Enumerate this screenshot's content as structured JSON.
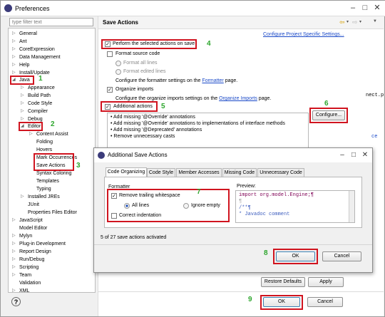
{
  "window": {
    "title": "Preferences"
  },
  "filter": {
    "placeholder": "type filter text"
  },
  "tree": {
    "general": "General",
    "ant": "Ant",
    "coreexpression": "CoreExpression",
    "data_management": "Data Management",
    "help": "Help",
    "install_update": "Install/Update",
    "java": "Java",
    "appearance": "Appearance",
    "build_path": "Build Path",
    "code_style": "Code Style",
    "compiler": "Compiler",
    "debug": "Debug",
    "editor": "Editor",
    "content_assist": "Content Assist",
    "folding": "Folding",
    "hovers": "Hovers",
    "mark_occurrences": "Mark Occurrences",
    "save_actions": "Save Actions",
    "syntax_coloring": "Syntax Coloring",
    "templates": "Templates",
    "typing": "Typing",
    "installed_jres": "Installed JREs",
    "junit": "JUnit",
    "properties_files_editor": "Properties Files Editor",
    "javascript": "JavaScript",
    "model_editor": "Model Editor",
    "mylyn": "Mylyn",
    "plugin_development": "Plug-in Development",
    "report_design": "Report Design",
    "run_debug": "Run/Debug",
    "scripting": "Scripting",
    "team": "Team",
    "validation": "Validation",
    "xml": "XML"
  },
  "page": {
    "title": "Save Actions",
    "config_link": "Configure Project Specific Settings...",
    "perform_label": "Perform the selected actions on save",
    "format_source_label": "Format source code",
    "format_all_lines": "Format all lines",
    "format_edited_lines": "Format edited lines",
    "formatter_text_pre": "Configure the formatter settings on the",
    "formatter_link": "Formatter",
    "formatter_text_post": "page.",
    "organize_imports_label": "Organize imports",
    "organize_text_pre": "Configure the organize imports settings on the",
    "organize_link": "Organize Imports",
    "organize_text_post": "page.",
    "additional_label": "Additional actions",
    "actions": [
      "Add missing '@Override' annotations",
      "Add missing '@Override' annotations to implementations of interface methods",
      "Add missing '@Deprecated' annotations",
      "Remove unnecessary casts"
    ],
    "configure_button": "Configure...",
    "restore_defaults": "Restore Defaults",
    "apply": "Apply",
    "ok": "OK",
    "cancel": "Cancel"
  },
  "dialog": {
    "title": "Additional Save Actions",
    "tabs": [
      "Code Organizing",
      "Code Style",
      "Member Accesses",
      "Missing Code",
      "Unnecessary Code"
    ],
    "formatter_group": "Formatter",
    "remove_trailing": "Remove trailing whitespace",
    "all_lines": "All lines",
    "ignore_empty": "Ignore empty",
    "correct_indentation": "Correct indentation",
    "preview_label": "Preview:",
    "code_lines": [
      "import org.model.Engine;¶",
      "¶",
      "/**¶",
      " * Javadoc comment"
    ],
    "status": "5 of 27 save actions activated",
    "ok": "OK",
    "cancel": "Cancel"
  },
  "annotations": [
    "1",
    "2",
    "3",
    "4",
    "5",
    "6",
    "7",
    "8",
    "9"
  ],
  "editor_bg": {
    "line1": "nect.p",
    "line2": "ce"
  }
}
